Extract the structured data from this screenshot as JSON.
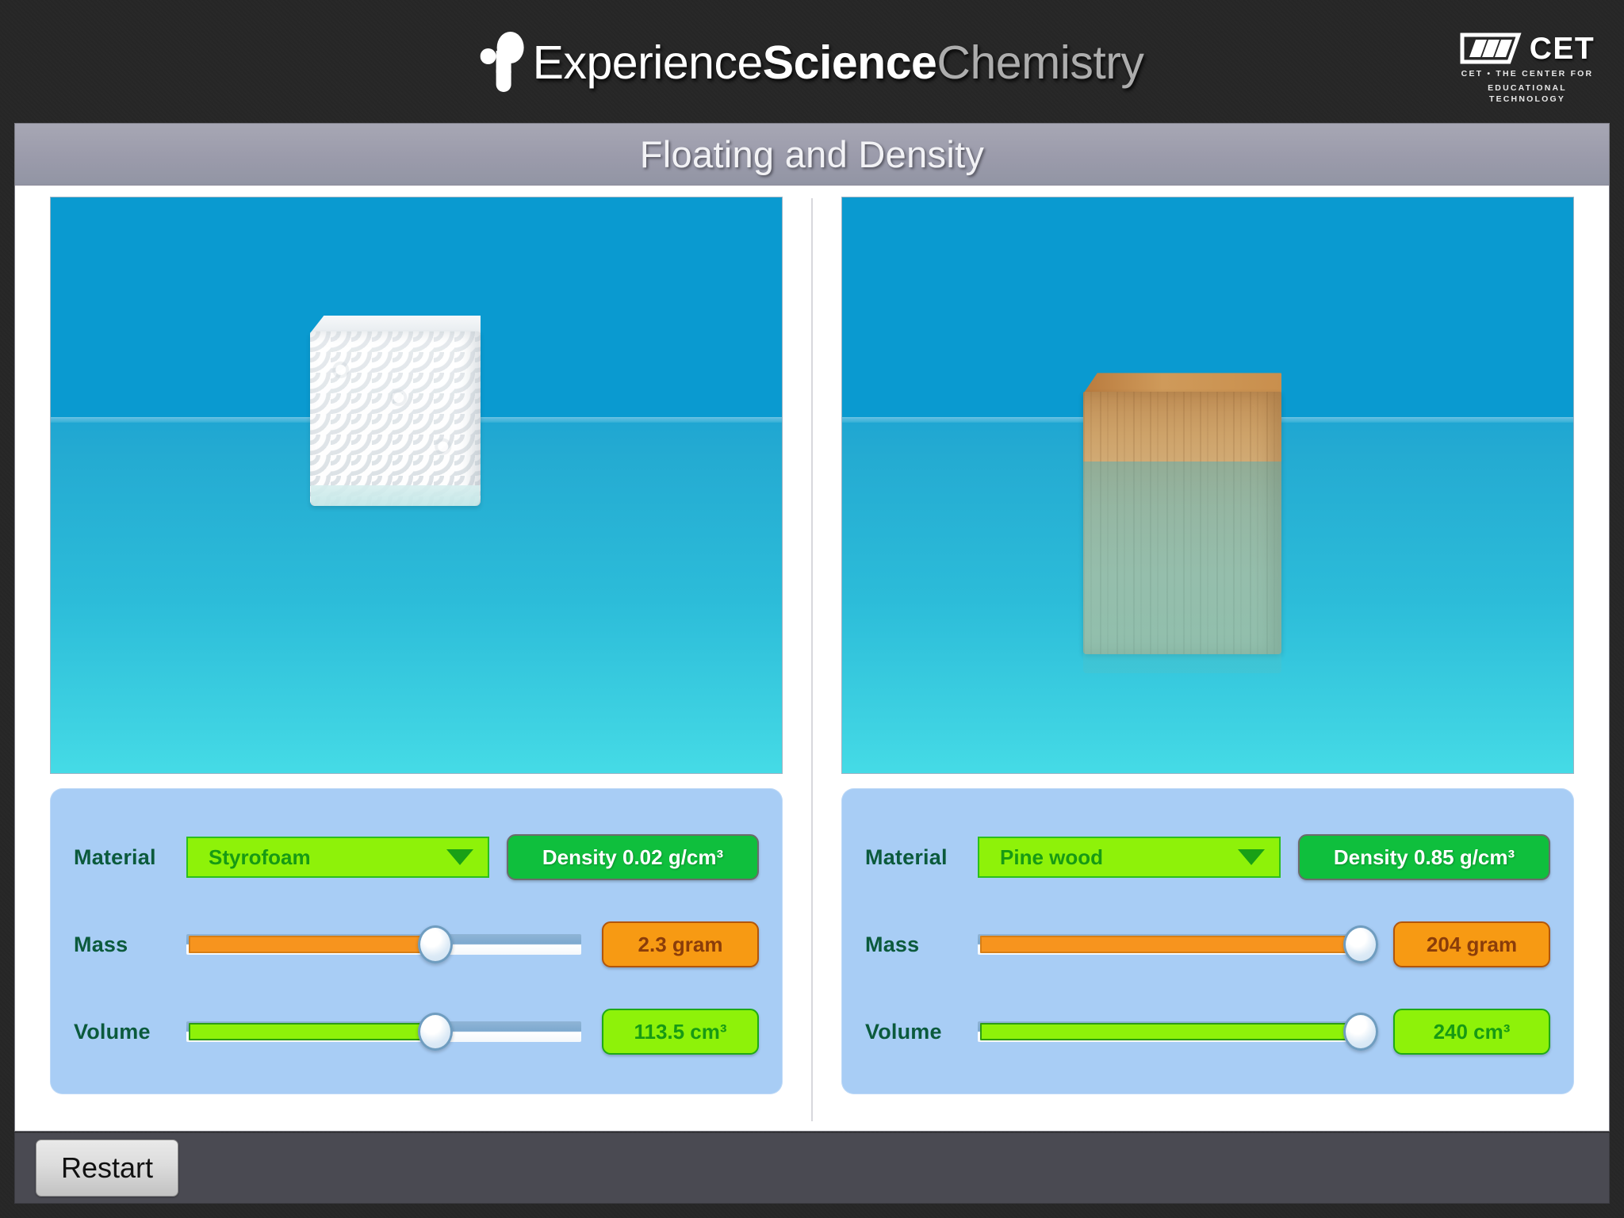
{
  "brand": {
    "logo_word1": "Experience",
    "logo_word2": "Science",
    "logo_word3": "Chemistry",
    "logo_mark": "molecule-icon",
    "cet_name": "CET",
    "cet_mark": "cet-stripes-icon",
    "cet_sub_line1": "CET • THE CENTER FOR",
    "cet_sub_line2": "EDUCATIONAL TECHNOLOGY"
  },
  "activity": {
    "title": "Floating and Density"
  },
  "panels": [
    {
      "id": "left",
      "simulation": {
        "object": "styrofoam-block",
        "water_label": "water",
        "state": "floating-high"
      },
      "material": {
        "label": "Material",
        "value": "Styrofoam",
        "arrow_icon": "chevron-down-icon"
      },
      "density": {
        "text": "Density 0.02 g/cm³"
      },
      "mass": {
        "label": "Mass",
        "value_text": "2.3 gram",
        "slider_percent": 63
      },
      "volume": {
        "label": "Volume",
        "value_text": "113.5 cm³",
        "slider_percent": 63
      }
    },
    {
      "id": "right",
      "simulation": {
        "object": "pine-wood-block",
        "water_label": "water",
        "state": "floating-low"
      },
      "material": {
        "label": "Material",
        "value": "Pine wood",
        "arrow_icon": "chevron-down-icon"
      },
      "density": {
        "text": "Density 0.85 g/cm³"
      },
      "mass": {
        "label": "Mass",
        "value_text": "204 gram",
        "slider_percent": 97
      },
      "volume": {
        "label": "Volume",
        "value_text": "240 cm³",
        "slider_percent": 97
      }
    }
  ],
  "footer": {
    "restart_label": "Restart"
  },
  "colors": {
    "water_top": "#0a9ad0",
    "water_bottom": "#45dbe6",
    "controls_bg": "#a8cdf5",
    "accent_green": "#8ef209",
    "density_green": "#0fbf3d",
    "mass_orange": "#f79a13",
    "label_green": "#0b5a3c",
    "titlebar": "#9b9bab",
    "frame_dark": "#262626",
    "bottom_bar": "#4a4a52"
  }
}
